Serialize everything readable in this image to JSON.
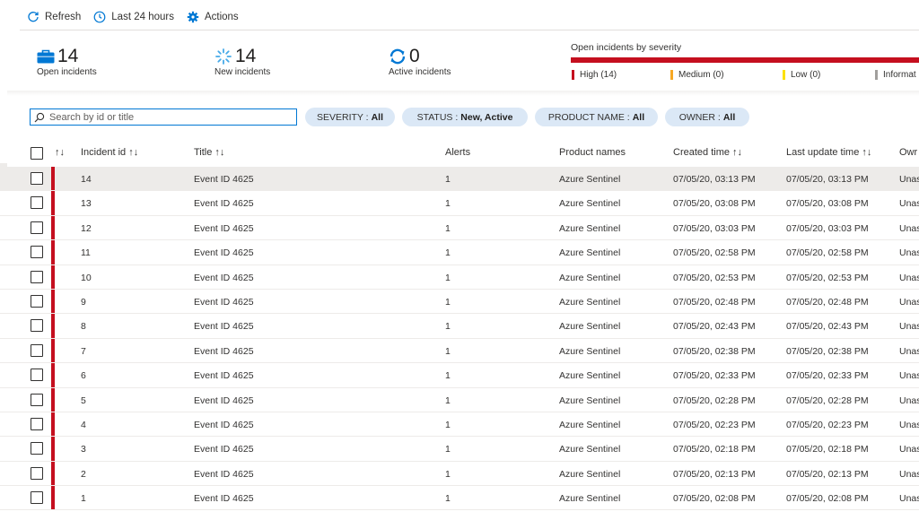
{
  "toolbar": {
    "refresh": "Refresh",
    "timerange": "Last 24 hours",
    "actions": "Actions"
  },
  "summary": {
    "open": {
      "value": "14",
      "label": "Open incidents"
    },
    "new": {
      "value": "14",
      "label": "New incidents"
    },
    "active": {
      "value": "0",
      "label": "Active incidents"
    },
    "severity_title": "Open incidents by severity",
    "severity": [
      {
        "label": "High (14)",
        "color": "#c50f1f"
      },
      {
        "label": "Medium (0)",
        "color": "#f7a823"
      },
      {
        "label": "Low (0)",
        "color": "#fce100"
      },
      {
        "label": "Informat",
        "color": "#a19f9d"
      }
    ]
  },
  "filters": {
    "search_placeholder": "Search by id or title",
    "severity": {
      "key": "SEVERITY :",
      "value": "All"
    },
    "status": {
      "key": "STATUS :",
      "value": "New, Active"
    },
    "product": {
      "key": "PRODUCT NAME :",
      "value": "All"
    },
    "owner": {
      "key": "OWNER :",
      "value": "All"
    }
  },
  "table": {
    "columns": {
      "sort_glyph": "↑↓",
      "incident_id": "Incident id ↑↓",
      "title": "Title ↑↓",
      "alerts": "Alerts",
      "product": "Product names",
      "created": "Created time ↑↓",
      "updated": "Last update time ↑↓",
      "owner": "Owr"
    },
    "rows": [
      {
        "id": "14",
        "title": "Event ID 4625",
        "alerts": "1",
        "product": "Azure Sentinel",
        "created": "07/05/20, 03:13 PM",
        "updated": "07/05/20, 03:13 PM",
        "owner": "Unas"
      },
      {
        "id": "13",
        "title": "Event ID 4625",
        "alerts": "1",
        "product": "Azure Sentinel",
        "created": "07/05/20, 03:08 PM",
        "updated": "07/05/20, 03:08 PM",
        "owner": "Unas"
      },
      {
        "id": "12",
        "title": "Event ID 4625",
        "alerts": "1",
        "product": "Azure Sentinel",
        "created": "07/05/20, 03:03 PM",
        "updated": "07/05/20, 03:03 PM",
        "owner": "Unas"
      },
      {
        "id": "11",
        "title": "Event ID 4625",
        "alerts": "1",
        "product": "Azure Sentinel",
        "created": "07/05/20, 02:58 PM",
        "updated": "07/05/20, 02:58 PM",
        "owner": "Unas"
      },
      {
        "id": "10",
        "title": "Event ID 4625",
        "alerts": "1",
        "product": "Azure Sentinel",
        "created": "07/05/20, 02:53 PM",
        "updated": "07/05/20, 02:53 PM",
        "owner": "Unas"
      },
      {
        "id": "9",
        "title": "Event ID 4625",
        "alerts": "1",
        "product": "Azure Sentinel",
        "created": "07/05/20, 02:48 PM",
        "updated": "07/05/20, 02:48 PM",
        "owner": "Unas"
      },
      {
        "id": "8",
        "title": "Event ID 4625",
        "alerts": "1",
        "product": "Azure Sentinel",
        "created": "07/05/20, 02:43 PM",
        "updated": "07/05/20, 02:43 PM",
        "owner": "Unas"
      },
      {
        "id": "7",
        "title": "Event ID 4625",
        "alerts": "1",
        "product": "Azure Sentinel",
        "created": "07/05/20, 02:38 PM",
        "updated": "07/05/20, 02:38 PM",
        "owner": "Unas"
      },
      {
        "id": "6",
        "title": "Event ID 4625",
        "alerts": "1",
        "product": "Azure Sentinel",
        "created": "07/05/20, 02:33 PM",
        "updated": "07/05/20, 02:33 PM",
        "owner": "Unas"
      },
      {
        "id": "5",
        "title": "Event ID 4625",
        "alerts": "1",
        "product": "Azure Sentinel",
        "created": "07/05/20, 02:28 PM",
        "updated": "07/05/20, 02:28 PM",
        "owner": "Unas"
      },
      {
        "id": "4",
        "title": "Event ID 4625",
        "alerts": "1",
        "product": "Azure Sentinel",
        "created": "07/05/20, 02:23 PM",
        "updated": "07/05/20, 02:23 PM",
        "owner": "Unas"
      },
      {
        "id": "3",
        "title": "Event ID 4625",
        "alerts": "1",
        "product": "Azure Sentinel",
        "created": "07/05/20, 02:18 PM",
        "updated": "07/05/20, 02:18 PM",
        "owner": "Unas"
      },
      {
        "id": "2",
        "title": "Event ID 4625",
        "alerts": "1",
        "product": "Azure Sentinel",
        "created": "07/05/20, 02:13 PM",
        "updated": "07/05/20, 02:13 PM",
        "owner": "Unas"
      },
      {
        "id": "1",
        "title": "Event ID 4625",
        "alerts": "1",
        "product": "Azure Sentinel",
        "created": "07/05/20, 02:08 PM",
        "updated": "07/05/20, 02:08 PM",
        "owner": "Unas"
      }
    ]
  },
  "colors": {
    "accent": "#0078d4",
    "high": "#c50f1f",
    "pill": "#dbe8f6"
  }
}
